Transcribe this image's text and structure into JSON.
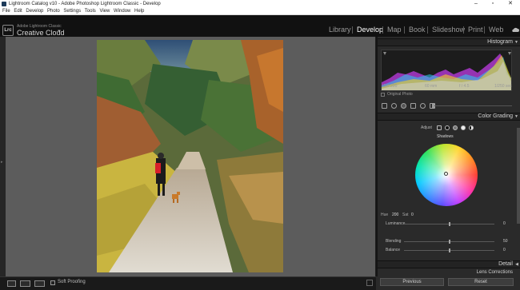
{
  "window": {
    "title": "Lightroom Catalog v10 - Adobe Photoshop Lightroom Classic - Develop",
    "minimize": "–",
    "maximize": "▫",
    "close": "✕"
  },
  "menu": [
    "File",
    "Edit",
    "Develop",
    "Photo",
    "Settings",
    "Tools",
    "View",
    "Window",
    "Help"
  ],
  "identity": {
    "logo": "Lrc",
    "line1": "Adobe Lightroom Classic",
    "line2": "Creative Cloud",
    "caret": "▼"
  },
  "modules": {
    "items": [
      "Library",
      "Develop",
      "Map",
      "Book",
      "Slideshow",
      "Print",
      "Web"
    ],
    "active": "Develop"
  },
  "histogram": {
    "title": "Histogram",
    "stats": {
      "iso": "ISO 200",
      "focal": "60 mm",
      "aperture": "f / 4.5",
      "shutter": "1/250 sec"
    },
    "original_photo_label": "Original Photo"
  },
  "color_grading": {
    "title": "Color Grading",
    "adjust_label": "Adjust",
    "wheel_label": "Shadows",
    "hue_label": "Hue",
    "hue_value": "200",
    "sat_label": "Sat",
    "sat_value": "0",
    "luminance_label": "Luminance",
    "luminance_value": "0",
    "blending_label": "Blending",
    "blending_value": "50",
    "balance_label": "Balance",
    "balance_value": "0"
  },
  "sections": {
    "detail": "Detail",
    "lens": "Lens Corrections"
  },
  "toolbar": {
    "soft_proofing": "Soft Proofing"
  },
  "buttons": {
    "previous": "Previous",
    "reset": "Reset"
  },
  "icons": [
    "app-icon",
    "lrc-logo",
    "cloud-icon",
    "crop-tool-icon",
    "spot-removal-icon",
    "red-eye-icon",
    "graduated-filter-icon",
    "radial-filter-icon",
    "brush-icon",
    "loupe-view-icon",
    "compare-view-icon"
  ],
  "colors": {
    "accent": "#ffffff",
    "panel": "#2a2a2a",
    "canvas": "#5c5c5c"
  }
}
